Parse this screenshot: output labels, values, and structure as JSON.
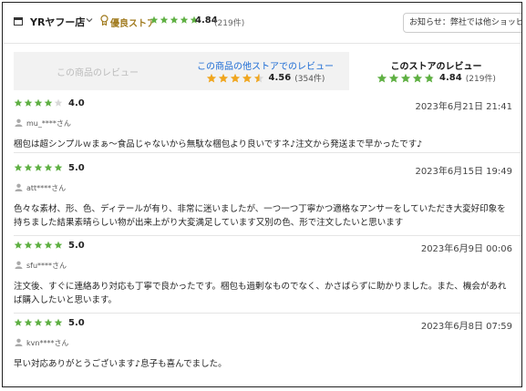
{
  "header": {
    "store_name": "YRヤフー店",
    "badge_label": "優良ストア",
    "rating": "4.84",
    "count": "(219件)",
    "notice": "お知らせ：弊社では他ショッピングサイ"
  },
  "tabs": [
    {
      "title": "この商品のレビュー",
      "rating": 0,
      "score": "",
      "count": ""
    },
    {
      "title": "この商品の他ストアでのレビュー",
      "rating": 4.56,
      "score": "4.56",
      "count": "(354件)"
    },
    {
      "title": "このストアのレビュー",
      "rating": 4.84,
      "score": "4.84",
      "count": "(219件)"
    }
  ],
  "colors": {
    "star": "#5fb043",
    "star_empty": "#d9d9d9",
    "star_gold": "#f0a61f",
    "badge": "#a07a1d",
    "link_blue": "#1c6bd4"
  },
  "reviews": [
    {
      "stars": 4,
      "rating": "4.0",
      "date": "2023年6月21日 21:41",
      "user": "mu_****さん",
      "body": "梱包は超シンプルｗまぁ～食品じゃないから無駄な梱包より良いですネ♪注文から発送まで早かったです♪"
    },
    {
      "stars": 5,
      "rating": "5.0",
      "date": "2023年6月15日 19:49",
      "user": "att****さん",
      "body": "色々な素材、形、色、ディテールが有り、非常に迷いましたが、一つ一つ丁寧かつ適格なアンサーをしていただき大変好印象を持ちました結果素晴らしい物が出来上がり大変満足しています又別の色、形で注文したいと思います"
    },
    {
      "stars": 5,
      "rating": "5.0",
      "date": "2023年6月9日 00:06",
      "user": "sfu****さん",
      "body": "注文後、すぐに連絡あり対応も丁寧で良かったです。梱包も過剰なものでなく、かさばらずに助かりました。また、機会があれば購入したいと思います。"
    },
    {
      "stars": 5,
      "rating": "5.0",
      "date": "2023年6月8日 07:59",
      "user": "kvn****さん",
      "body": "早い対応ありがとうございます♪息子も喜んでました。"
    }
  ]
}
